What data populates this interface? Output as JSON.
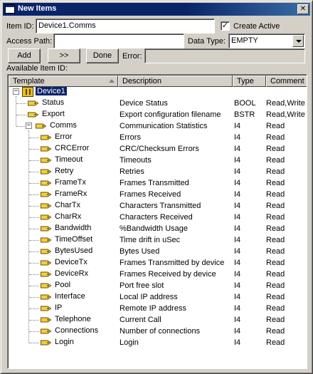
{
  "window": {
    "title": "New Items",
    "close_glyph": "✕"
  },
  "form": {
    "item_id_label": "Item ID:",
    "item_id_value": "Device1.Comms",
    "create_active_label": "Create Active",
    "create_active_checked": true,
    "access_path_label": "Access Path:",
    "access_path_value": "",
    "data_type_label": "Data Type:",
    "data_type_value": "EMPTY",
    "error_label": "Error:",
    "error_value": ""
  },
  "buttons": {
    "add": "Add",
    "forward": ">>",
    "done": "Done"
  },
  "available_label": "Available Item ID:",
  "columns": {
    "template": "Template",
    "description": "Description",
    "type": "Type",
    "comment": "Comment"
  },
  "tree": {
    "root": "Device1",
    "items": [
      {
        "name": "Status",
        "description": "Device Status",
        "type": "BOOL",
        "comment": "Read,Write"
      },
      {
        "name": "Export",
        "description": "Export configuration filename",
        "type": "BSTR",
        "comment": "Read,Write"
      },
      {
        "name": "Comms",
        "description": "Communication Statistics",
        "type": "I4",
        "comment": "Read"
      }
    ],
    "comms_children": [
      {
        "name": "Error",
        "description": "Errors",
        "type": "I4",
        "comment": "Read"
      },
      {
        "name": "CRCError",
        "description": "CRC/Checksum Errors",
        "type": "I4",
        "comment": "Read"
      },
      {
        "name": "Timeout",
        "description": "Timeouts",
        "type": "I4",
        "comment": "Read"
      },
      {
        "name": "Retry",
        "description": "Retries",
        "type": "I4",
        "comment": "Read"
      },
      {
        "name": "FrameTx",
        "description": "Frames Transmitted",
        "type": "I4",
        "comment": "Read"
      },
      {
        "name": "FrameRx",
        "description": "Frames Received",
        "type": "I4",
        "comment": "Read"
      },
      {
        "name": "CharTx",
        "description": "Characters Transmitted",
        "type": "I4",
        "comment": "Read"
      },
      {
        "name": "CharRx",
        "description": "Characters Received",
        "type": "I4",
        "comment": "Read"
      },
      {
        "name": "Bandwidth",
        "description": "%Bandwidth Usage",
        "type": "I4",
        "comment": "Read"
      },
      {
        "name": "TimeOffset",
        "description": "Time drift in uSec",
        "type": "I4",
        "comment": "Read"
      },
      {
        "name": "BytesUsed",
        "description": "Bytes Used",
        "type": "I4",
        "comment": "Read"
      },
      {
        "name": "DeviceTx",
        "description": "Frames Transmitted by device",
        "type": "I4",
        "comment": "Read"
      },
      {
        "name": "DeviceRx",
        "description": "Frames Received by device",
        "type": "I4",
        "comment": "Read"
      },
      {
        "name": "Pool",
        "description": "Port free slot",
        "type": "I4",
        "comment": "Read"
      },
      {
        "name": "Interface",
        "description": "Local IP address",
        "type": "I4",
        "comment": "Read"
      },
      {
        "name": "IP",
        "description": "Remote IP address",
        "type": "I4",
        "comment": "Read"
      },
      {
        "name": "Telephone",
        "description": "Current Call",
        "type": "I4",
        "comment": "Read"
      },
      {
        "name": "Connections",
        "description": "Number of connections",
        "type": "I4",
        "comment": "Read"
      },
      {
        "name": "Login",
        "description": "Login",
        "type": "I4",
        "comment": "Read"
      }
    ]
  },
  "colors": {
    "selection": "#0a246a",
    "titlebar": "#0a246a",
    "tag_icon_fill": "#f0d040",
    "tag_icon_stroke": "#6a5000"
  }
}
